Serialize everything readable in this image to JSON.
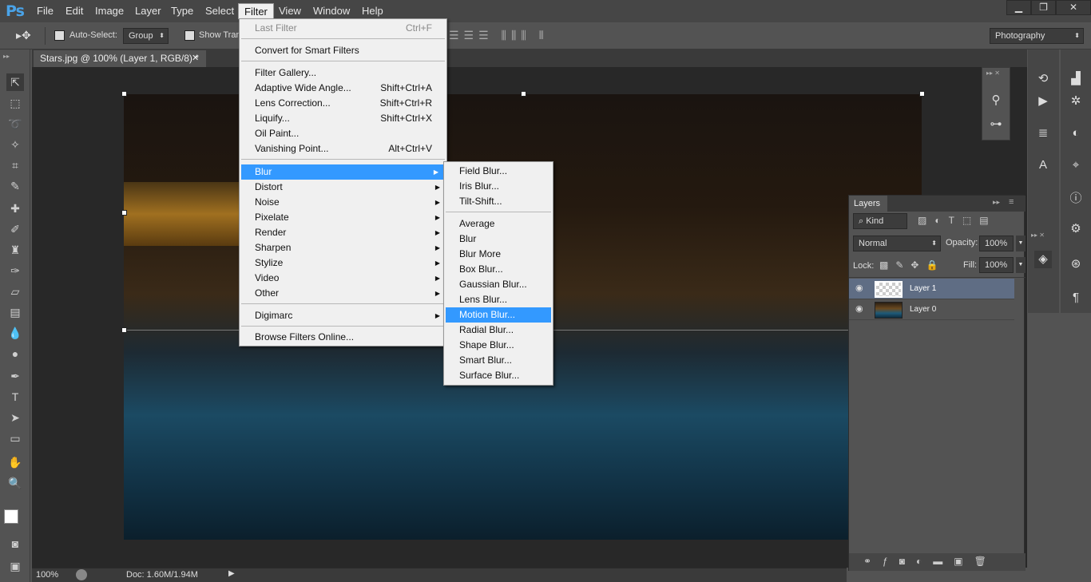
{
  "menubar": {
    "items": [
      "File",
      "Edit",
      "Image",
      "Layer",
      "Type",
      "Select",
      "Filter",
      "View",
      "Window",
      "Help"
    ],
    "active": "Filter",
    "logo": "Ps"
  },
  "options": {
    "auto_select_label": "Auto-Select:",
    "group_value": "Group",
    "show_transform_label": "Show Tran",
    "workspace": "Photography"
  },
  "document": {
    "tab_title": "Stars.jpg @ 100% (Layer 1, RGB/8) *",
    "zoom": "100%",
    "doc_info": "Doc: 1.60M/1.94M"
  },
  "filter_menu": {
    "last_filter": {
      "label": "Last Filter",
      "shortcut": "Ctrl+F"
    },
    "convert": "Convert for Smart Filters",
    "group1": [
      {
        "label": "Filter Gallery...",
        "shortcut": ""
      },
      {
        "label": "Adaptive Wide Angle...",
        "shortcut": "Shift+Ctrl+A"
      },
      {
        "label": "Lens Correction...",
        "shortcut": "Shift+Ctrl+R"
      },
      {
        "label": "Liquify...",
        "shortcut": "Shift+Ctrl+X"
      },
      {
        "label": "Oil Paint...",
        "shortcut": ""
      },
      {
        "label": "Vanishing Point...",
        "shortcut": "Alt+Ctrl+V"
      }
    ],
    "submenus": [
      "Blur",
      "Distort",
      "Noise",
      "Pixelate",
      "Render",
      "Sharpen",
      "Stylize",
      "Video",
      "Other"
    ],
    "digimarc": "Digimarc",
    "browse": "Browse Filters Online..."
  },
  "blur_menu": {
    "group1": [
      "Field Blur...",
      "Iris Blur...",
      "Tilt-Shift..."
    ],
    "group2": [
      "Average",
      "Blur",
      "Blur More",
      "Box Blur...",
      "Gaussian Blur...",
      "Lens Blur...",
      "Motion Blur...",
      "Radial Blur...",
      "Shape Blur...",
      "Smart Blur...",
      "Surface Blur..."
    ],
    "highlighted": "Motion Blur..."
  },
  "layers_panel": {
    "title": "Layers",
    "kind": "Kind",
    "blend_mode": "Normal",
    "opacity_label": "Opacity:",
    "opacity": "100%",
    "lock_label": "Lock:",
    "fill_label": "Fill:",
    "fill": "100%",
    "layers": [
      {
        "name": "Layer 1",
        "selected": true
      },
      {
        "name": "Layer 0",
        "selected": false
      }
    ]
  },
  "colors": {
    "menu_highlight": "#3399ff",
    "ps_blue": "#4aa3e8"
  }
}
